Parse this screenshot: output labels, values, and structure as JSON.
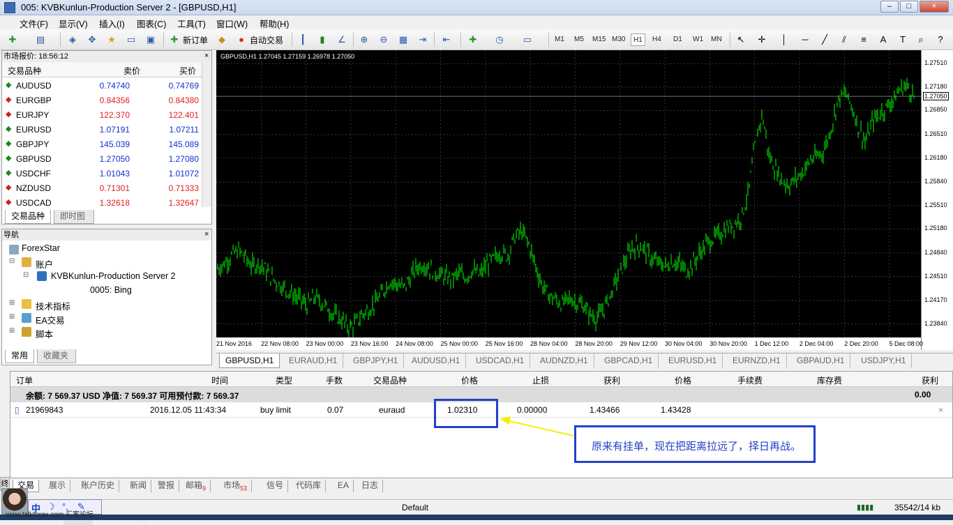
{
  "window": {
    "title": "005: KVBKunlun-Production Server 2 - [GBPUSD,H1]",
    "buttons": [
      "–",
      "□",
      "×"
    ]
  },
  "menu": [
    "文件(F)",
    "显示(V)",
    "插入(I)",
    "图表(C)",
    "工具(T)",
    "窗口(W)",
    "帮助(H)"
  ],
  "toolbar": {
    "new_order": "新订单",
    "auto_trade": "自动交易",
    "timeframes": [
      "M1",
      "M5",
      "M15",
      "M30",
      "H1",
      "H4",
      "D1",
      "W1",
      "MN"
    ],
    "active_tf": "H1"
  },
  "market_watch": {
    "title": "市场报价: 18:56:12",
    "headers": {
      "symbol": "交易品种",
      "bid": "卖价",
      "ask": "买价"
    },
    "rows": [
      {
        "symbol": "AUDUSD",
        "bid": "0.74740",
        "ask": "0.74769",
        "dir": "up"
      },
      {
        "symbol": "EURGBP",
        "bid": "0.84356",
        "ask": "0.84380",
        "dir": "down"
      },
      {
        "symbol": "EURJPY",
        "bid": "122.370",
        "ask": "122.401",
        "dir": "down"
      },
      {
        "symbol": "EURUSD",
        "bid": "1.07191",
        "ask": "1.07211",
        "dir": "up"
      },
      {
        "symbol": "GBPJPY",
        "bid": "145.039",
        "ask": "145.089",
        "dir": "up"
      },
      {
        "symbol": "GBPUSD",
        "bid": "1.27050",
        "ask": "1.27080",
        "dir": "up"
      },
      {
        "symbol": "USDCHF",
        "bid": "1.01043",
        "ask": "1.01072",
        "dir": "up"
      },
      {
        "symbol": "NZDUSD",
        "bid": "0.71301",
        "ask": "0.71333",
        "dir": "down"
      },
      {
        "symbol": "USDCAD",
        "bid": "1.32618",
        "ask": "1.32647",
        "dir": "down"
      }
    ],
    "tabs": [
      "交易品种",
      "即时图"
    ]
  },
  "navigator": {
    "title": "导航",
    "root": "ForexStar",
    "accounts": "账户",
    "server": "KVBKunlun-Production Server 2",
    "account": "0005: Bing",
    "indicators": "技术指标",
    "ea": "EA交易",
    "scripts": "脚本",
    "tabs": [
      "常用",
      "收藏夹"
    ]
  },
  "chart": {
    "header": "GBPUSD,H1  1.27045 1.27159 1.26978 1.27050",
    "current_price": "1.27050",
    "price_ticks": [
      "1.27510",
      "1.27180",
      "1.26850",
      "1.26510",
      "1.26180",
      "1.25840",
      "1.25510",
      "1.25180",
      "1.24840",
      "1.24510",
      "1.24170",
      "1.23840"
    ],
    "time_ticks": [
      "21 Nov 2016",
      "22 Nov 08:00",
      "23 Nov 00:00",
      "23 Nov 16:00",
      "24 Nov 08:00",
      "25 Nov 00:00",
      "25 Nov 16:00",
      "28 Nov 04:00",
      "28 Nov 20:00",
      "29 Nov 12:00",
      "30 Nov 04:00",
      "30 Nov 20:00",
      "1 Dec 12:00",
      "2 Dec 04:00",
      "2 Dec 20:00",
      "5 Dec 08:00"
    ],
    "tabs": [
      "GBPUSD,H1",
      "EURAUD,H1",
      "GBPJPY,H1",
      "AUDUSD,H1",
      "USDCAD,H1",
      "AUDNZD,H1",
      "GBPCAD,H1",
      "EURUSD,H1",
      "EURNZD,H1",
      "GBPAUD,H1",
      "USDJPY,H1"
    ]
  },
  "terminal": {
    "headers": {
      "order": "订单",
      "time": "时间",
      "type": "类型",
      "lots": "手数",
      "symbol": "交易品种",
      "price": "价格",
      "sl": "止损",
      "tp": "获利",
      "cur_price": "价格",
      "commission": "手续费",
      "swap": "库存费",
      "profit": "获利"
    },
    "balance_line": "余额: 7 569.37 USD  净值: 7 569.37  可用预付款: 7 569.37",
    "total_profit": "0.00",
    "order": {
      "id": "21969843",
      "time": "2016.12.05 11:43:34",
      "type": "buy limit",
      "lots": "0.07",
      "symbol": "euraud",
      "price": "1.02310",
      "sl": "0.00000",
      "tp": "1.43466",
      "cur_price": "1.43428"
    },
    "tabs": [
      "交易",
      "展示",
      "账户历史",
      "新闻",
      "警报",
      "邮箱",
      "市场",
      "信号",
      "代码库",
      "EA",
      "日志"
    ],
    "mail_count": "9",
    "market_count": "53"
  },
  "annotation": "原来有挂单，现在把距离拉远了，择日再战。",
  "status": {
    "profile": "Default",
    "traffic": "35542/14 kb"
  },
  "watermark": "www.talkforex.com 汇客论坛",
  "side_tab": "终端",
  "ime": [
    "中",
    "☽",
    "°,",
    "✎"
  ],
  "series": [
    1.2462,
    1.247,
    1.248,
    1.2488,
    1.2478,
    1.2465,
    1.247,
    1.246,
    1.2448,
    1.244,
    1.2432,
    1.2425,
    1.2418,
    1.241,
    1.2422,
    1.2415,
    1.2406,
    1.2395,
    1.239,
    1.2378,
    1.2385,
    1.2398,
    1.2405,
    1.2415,
    1.243,
    1.2445,
    1.244,
    1.2435,
    1.245,
    1.2465,
    1.2468,
    1.246,
    1.2455,
    1.245,
    1.2448,
    1.2455,
    1.245,
    1.246,
    1.2452,
    1.2468,
    1.2475,
    1.2485,
    1.248,
    1.2505,
    1.2515,
    1.25,
    1.247,
    1.244,
    1.2425,
    1.2418,
    1.2412,
    1.242,
    1.2415,
    1.241,
    1.2398,
    1.2392,
    1.2405,
    1.2425,
    1.245,
    1.247,
    1.249,
    1.2495,
    1.2488,
    1.2475,
    1.247,
    1.2465,
    1.2472,
    1.2468,
    1.2458,
    1.247,
    1.2485,
    1.2498,
    1.2505,
    1.2512,
    1.252,
    1.2525,
    1.2535,
    1.257,
    1.264,
    1.268,
    1.262,
    1.26,
    1.2585,
    1.258,
    1.259,
    1.26,
    1.2615,
    1.262,
    1.263,
    1.266,
    1.27,
    1.271,
    1.269,
    1.266,
    1.264,
    1.267,
    1.268,
    1.269,
    1.27,
    1.2715,
    1.272,
    1.2705
  ]
}
